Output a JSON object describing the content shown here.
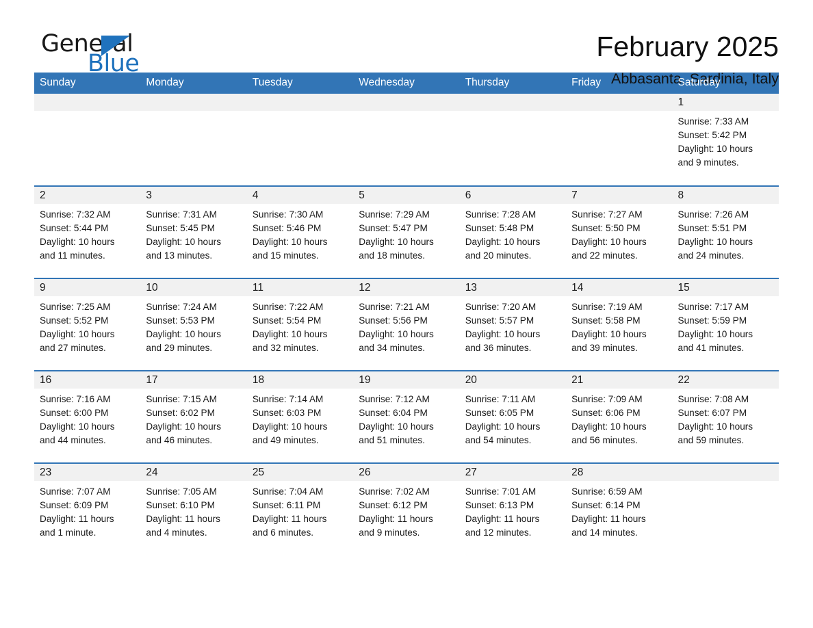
{
  "brand": {
    "name_part1": "General",
    "name_part2": "Blue",
    "flag_icon": "triangle-flag-icon"
  },
  "header": {
    "title": "February 2025",
    "subtitle": "Abbasanta, Sardinia, Italy"
  },
  "colors": {
    "header_blue": "#3275b6",
    "brand_blue": "#1f72bd",
    "daynum_band": "#f1f1f1",
    "text": "#1a1a1a"
  },
  "weekday_headers": [
    "Sunday",
    "Monday",
    "Tuesday",
    "Wednesday",
    "Thursday",
    "Friday",
    "Saturday"
  ],
  "weeks": [
    [
      {
        "day": "",
        "lines": []
      },
      {
        "day": "",
        "lines": []
      },
      {
        "day": "",
        "lines": []
      },
      {
        "day": "",
        "lines": []
      },
      {
        "day": "",
        "lines": []
      },
      {
        "day": "",
        "lines": []
      },
      {
        "day": "1",
        "sunrise": "Sunrise: 7:33 AM",
        "sunset": "Sunset: 5:42 PM",
        "daylight_line1": "Daylight: 10 hours",
        "daylight_line2": "and 9 minutes."
      }
    ],
    [
      {
        "day": "2",
        "sunrise": "Sunrise: 7:32 AM",
        "sunset": "Sunset: 5:44 PM",
        "daylight_line1": "Daylight: 10 hours",
        "daylight_line2": "and 11 minutes."
      },
      {
        "day": "3",
        "sunrise": "Sunrise: 7:31 AM",
        "sunset": "Sunset: 5:45 PM",
        "daylight_line1": "Daylight: 10 hours",
        "daylight_line2": "and 13 minutes."
      },
      {
        "day": "4",
        "sunrise": "Sunrise: 7:30 AM",
        "sunset": "Sunset: 5:46 PM",
        "daylight_line1": "Daylight: 10 hours",
        "daylight_line2": "and 15 minutes."
      },
      {
        "day": "5",
        "sunrise": "Sunrise: 7:29 AM",
        "sunset": "Sunset: 5:47 PM",
        "daylight_line1": "Daylight: 10 hours",
        "daylight_line2": "and 18 minutes."
      },
      {
        "day": "6",
        "sunrise": "Sunrise: 7:28 AM",
        "sunset": "Sunset: 5:48 PM",
        "daylight_line1": "Daylight: 10 hours",
        "daylight_line2": "and 20 minutes."
      },
      {
        "day": "7",
        "sunrise": "Sunrise: 7:27 AM",
        "sunset": "Sunset: 5:50 PM",
        "daylight_line1": "Daylight: 10 hours",
        "daylight_line2": "and 22 minutes."
      },
      {
        "day": "8",
        "sunrise": "Sunrise: 7:26 AM",
        "sunset": "Sunset: 5:51 PM",
        "daylight_line1": "Daylight: 10 hours",
        "daylight_line2": "and 24 minutes."
      }
    ],
    [
      {
        "day": "9",
        "sunrise": "Sunrise: 7:25 AM",
        "sunset": "Sunset: 5:52 PM",
        "daylight_line1": "Daylight: 10 hours",
        "daylight_line2": "and 27 minutes."
      },
      {
        "day": "10",
        "sunrise": "Sunrise: 7:24 AM",
        "sunset": "Sunset: 5:53 PM",
        "daylight_line1": "Daylight: 10 hours",
        "daylight_line2": "and 29 minutes."
      },
      {
        "day": "11",
        "sunrise": "Sunrise: 7:22 AM",
        "sunset": "Sunset: 5:54 PM",
        "daylight_line1": "Daylight: 10 hours",
        "daylight_line2": "and 32 minutes."
      },
      {
        "day": "12",
        "sunrise": "Sunrise: 7:21 AM",
        "sunset": "Sunset: 5:56 PM",
        "daylight_line1": "Daylight: 10 hours",
        "daylight_line2": "and 34 minutes."
      },
      {
        "day": "13",
        "sunrise": "Sunrise: 7:20 AM",
        "sunset": "Sunset: 5:57 PM",
        "daylight_line1": "Daylight: 10 hours",
        "daylight_line2": "and 36 minutes."
      },
      {
        "day": "14",
        "sunrise": "Sunrise: 7:19 AM",
        "sunset": "Sunset: 5:58 PM",
        "daylight_line1": "Daylight: 10 hours",
        "daylight_line2": "and 39 minutes."
      },
      {
        "day": "15",
        "sunrise": "Sunrise: 7:17 AM",
        "sunset": "Sunset: 5:59 PM",
        "daylight_line1": "Daylight: 10 hours",
        "daylight_line2": "and 41 minutes."
      }
    ],
    [
      {
        "day": "16",
        "sunrise": "Sunrise: 7:16 AM",
        "sunset": "Sunset: 6:00 PM",
        "daylight_line1": "Daylight: 10 hours",
        "daylight_line2": "and 44 minutes."
      },
      {
        "day": "17",
        "sunrise": "Sunrise: 7:15 AM",
        "sunset": "Sunset: 6:02 PM",
        "daylight_line1": "Daylight: 10 hours",
        "daylight_line2": "and 46 minutes."
      },
      {
        "day": "18",
        "sunrise": "Sunrise: 7:14 AM",
        "sunset": "Sunset: 6:03 PM",
        "daylight_line1": "Daylight: 10 hours",
        "daylight_line2": "and 49 minutes."
      },
      {
        "day": "19",
        "sunrise": "Sunrise: 7:12 AM",
        "sunset": "Sunset: 6:04 PM",
        "daylight_line1": "Daylight: 10 hours",
        "daylight_line2": "and 51 minutes."
      },
      {
        "day": "20",
        "sunrise": "Sunrise: 7:11 AM",
        "sunset": "Sunset: 6:05 PM",
        "daylight_line1": "Daylight: 10 hours",
        "daylight_line2": "and 54 minutes."
      },
      {
        "day": "21",
        "sunrise": "Sunrise: 7:09 AM",
        "sunset": "Sunset: 6:06 PM",
        "daylight_line1": "Daylight: 10 hours",
        "daylight_line2": "and 56 minutes."
      },
      {
        "day": "22",
        "sunrise": "Sunrise: 7:08 AM",
        "sunset": "Sunset: 6:07 PM",
        "daylight_line1": "Daylight: 10 hours",
        "daylight_line2": "and 59 minutes."
      }
    ],
    [
      {
        "day": "23",
        "sunrise": "Sunrise: 7:07 AM",
        "sunset": "Sunset: 6:09 PM",
        "daylight_line1": "Daylight: 11 hours",
        "daylight_line2": "and 1 minute."
      },
      {
        "day": "24",
        "sunrise": "Sunrise: 7:05 AM",
        "sunset": "Sunset: 6:10 PM",
        "daylight_line1": "Daylight: 11 hours",
        "daylight_line2": "and 4 minutes."
      },
      {
        "day": "25",
        "sunrise": "Sunrise: 7:04 AM",
        "sunset": "Sunset: 6:11 PM",
        "daylight_line1": "Daylight: 11 hours",
        "daylight_line2": "and 6 minutes."
      },
      {
        "day": "26",
        "sunrise": "Sunrise: 7:02 AM",
        "sunset": "Sunset: 6:12 PM",
        "daylight_line1": "Daylight: 11 hours",
        "daylight_line2": "and 9 minutes."
      },
      {
        "day": "27",
        "sunrise": "Sunrise: 7:01 AM",
        "sunset": "Sunset: 6:13 PM",
        "daylight_line1": "Daylight: 11 hours",
        "daylight_line2": "and 12 minutes."
      },
      {
        "day": "28",
        "sunrise": "Sunrise: 6:59 AM",
        "sunset": "Sunset: 6:14 PM",
        "daylight_line1": "Daylight: 11 hours",
        "daylight_line2": "and 14 minutes."
      },
      {
        "day": "",
        "lines": []
      }
    ]
  ]
}
